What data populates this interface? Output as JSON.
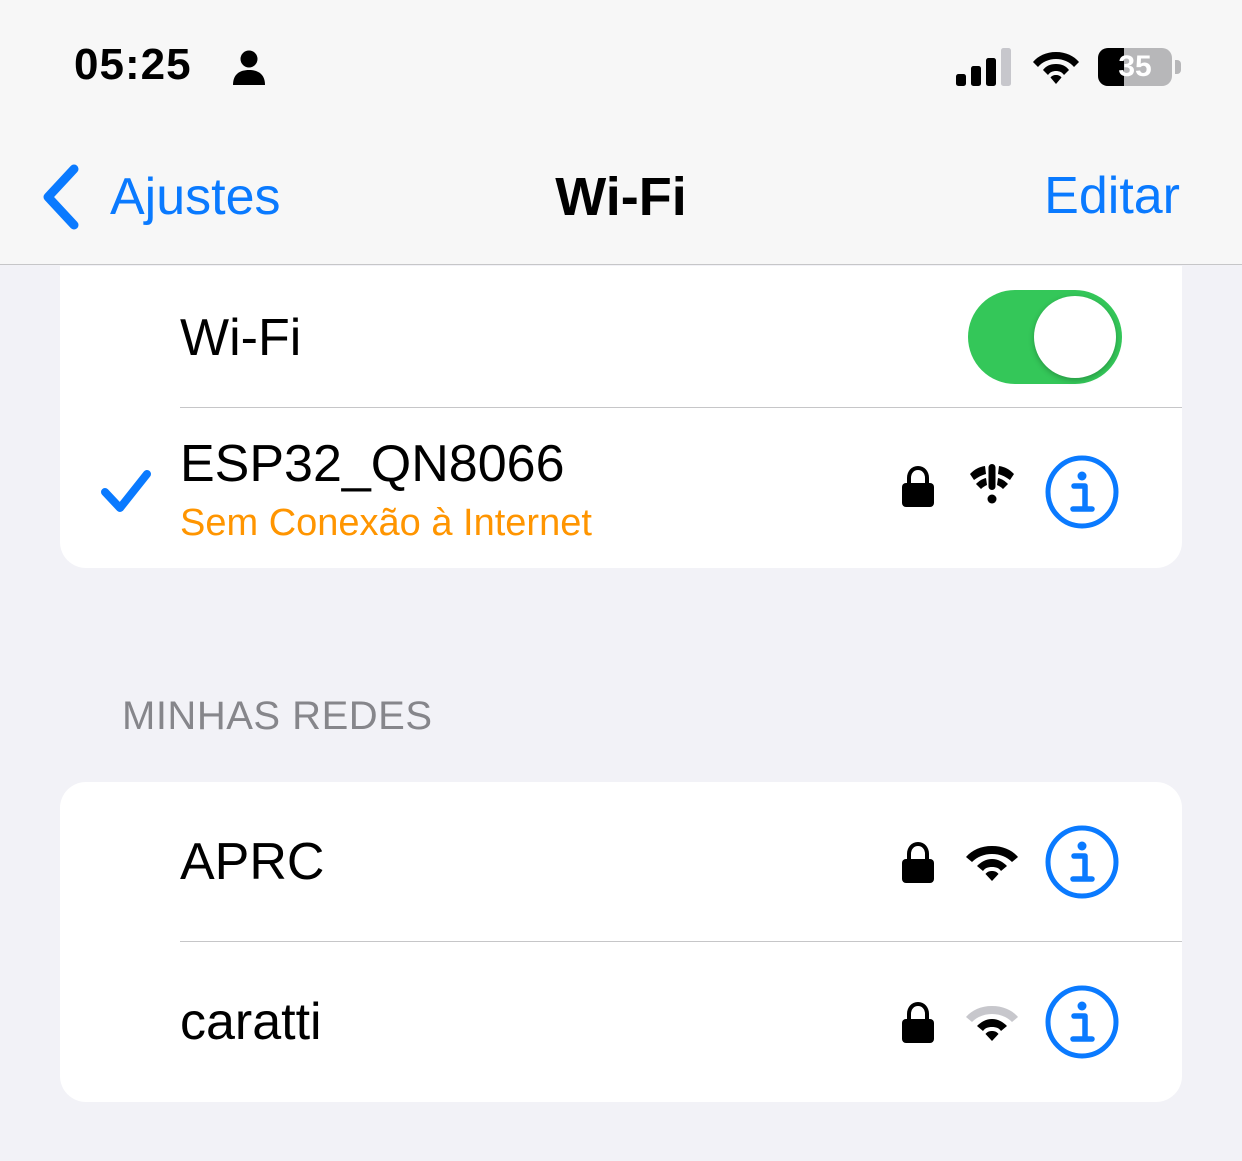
{
  "status_bar": {
    "time": "05:25",
    "battery_percent": "35",
    "battery_level": 0.35,
    "icons": [
      "person-icon",
      "cellular-signal-icon",
      "wifi-icon",
      "battery-icon"
    ]
  },
  "nav": {
    "back_label": "Ajustes",
    "title": "Wi-Fi",
    "edit_label": "Editar",
    "accent_color": "#0a7aff"
  },
  "wifi_toggle": {
    "label": "Wi-Fi",
    "on": true,
    "on_color": "#34c759"
  },
  "current_network": {
    "name": "ESP32_QN8066",
    "status": "Sem Conexão à Internet",
    "status_color": "#ff9500",
    "connected": true,
    "secured": true,
    "signal_icon": "wifi-exclamation-icon"
  },
  "my_networks": {
    "header": "MINHAS REDES",
    "items": [
      {
        "name": "APRC",
        "secured": true,
        "signal_bars": 3,
        "signal_icon": "wifi-icon"
      },
      {
        "name": "caratti",
        "secured": true,
        "signal_bars": 2,
        "signal_icon": "wifi-icon"
      }
    ]
  }
}
